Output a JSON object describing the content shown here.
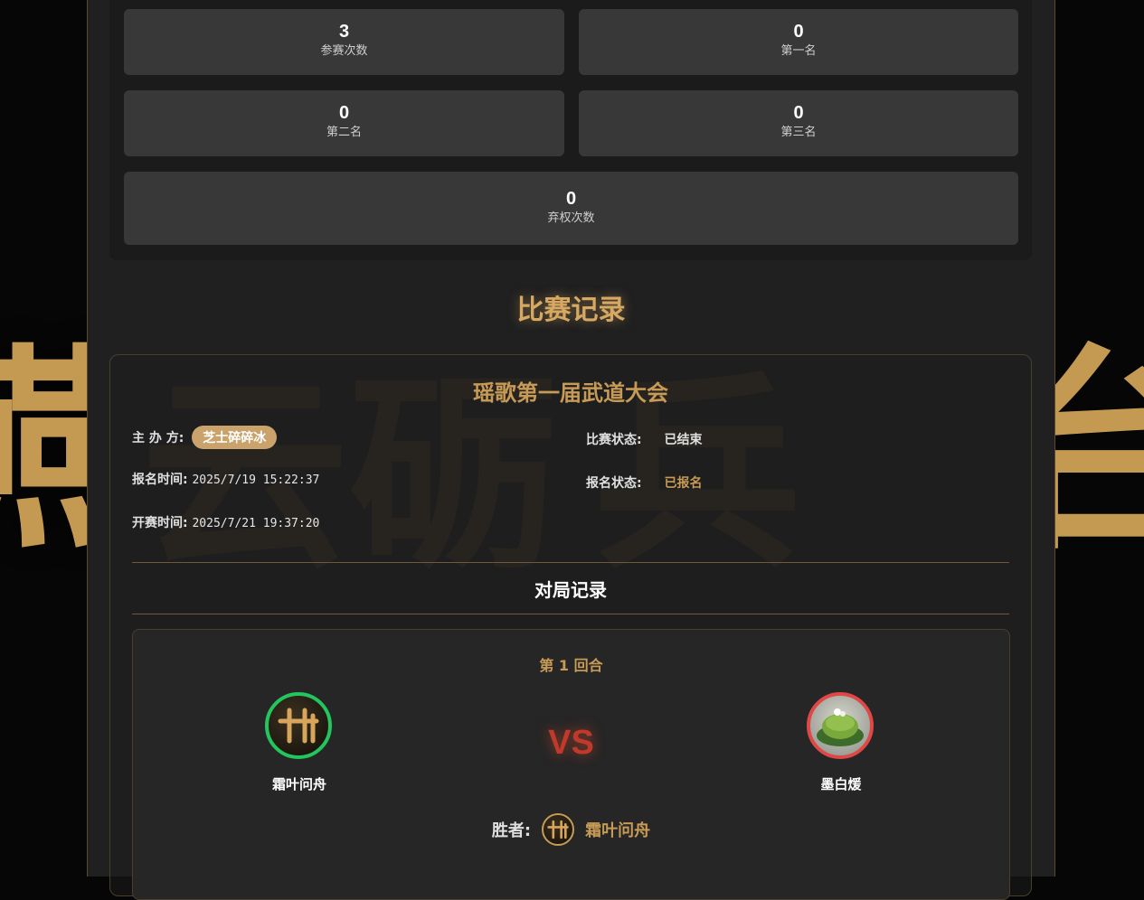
{
  "stats": [
    {
      "value": "3",
      "label": "参赛次数"
    },
    {
      "value": "0",
      "label": "第一名"
    },
    {
      "value": "0",
      "label": "第二名"
    },
    {
      "value": "0",
      "label": "第三名"
    },
    {
      "value": "0",
      "label": "弃权次数"
    }
  ],
  "section_title": "比赛记录",
  "event": {
    "name": "瑶歌第一届武道大会",
    "organizer_label": "主 办 方:",
    "organizer": "芝士碎碎冰",
    "signup_time_label": "报名时间:",
    "signup_time": "2025/7/19 15:22:37",
    "start_time_label": "开赛时间:",
    "start_time": "2025/7/21 19:37:20",
    "match_status_label": "比赛状态:",
    "match_status": "已结束",
    "signup_status_label": "报名状态:",
    "signup_status": "已报名"
  },
  "matches_title": "对局记录",
  "round": {
    "title": "第 1 回合",
    "player_a": "霜叶问舟",
    "player_b": "墨白煖",
    "vs": "VS",
    "winner_label": "胜者:",
    "winner": "霜叶问舟"
  },
  "colors": {
    "accent": "#c79a55",
    "win": "#22c55e",
    "lose": "#e04848",
    "vs": "#c0392b"
  }
}
